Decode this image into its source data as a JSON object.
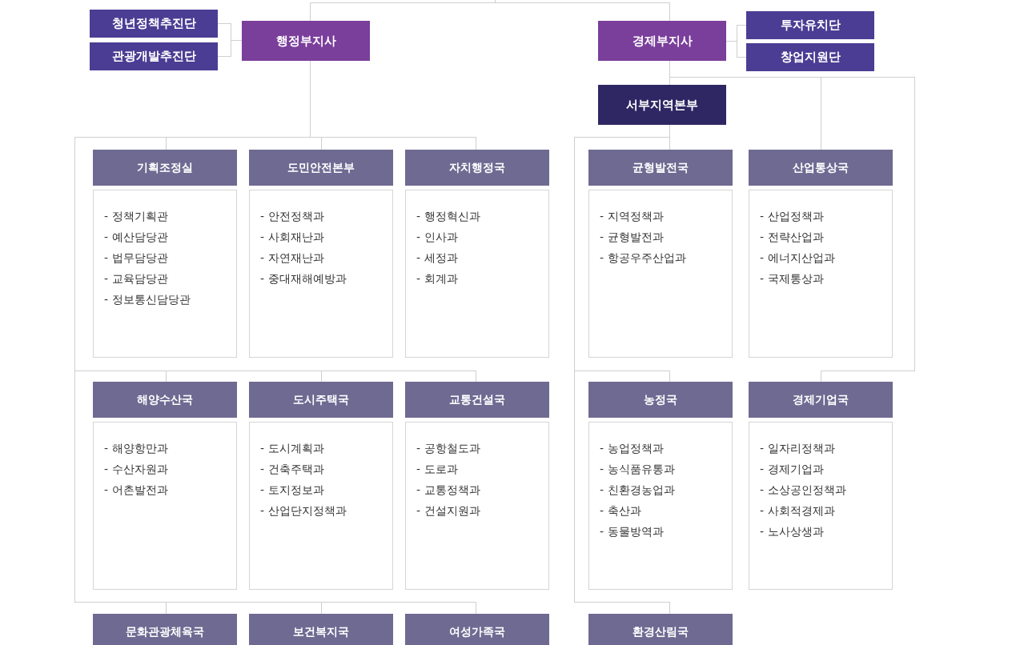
{
  "deputies": [
    {
      "name": "행정부지사",
      "kind": "deputy",
      "units": [
        {
          "name": "청년정책추진단",
          "kind": "unit"
        },
        {
          "name": "관광개발추진단",
          "kind": "unit"
        }
      ]
    },
    {
      "name": "경제부지사",
      "kind": "deputy",
      "units": [
        {
          "name": "투자유치단",
          "kind": "unit"
        },
        {
          "name": "창업지원단",
          "kind": "unit"
        }
      ]
    }
  ],
  "regional_hq": {
    "name": "서부지역본부",
    "kind": "hq"
  },
  "left_bureaus": [
    {
      "name": "기획조정실",
      "kind": "bureau",
      "items": [
        "- 정책기획관",
        "- 예산담당관",
        "- 법무담당관",
        "- 교육담당관",
        "- 정보통신담당관"
      ]
    },
    {
      "name": "도민안전본부",
      "kind": "bureau",
      "items": [
        "- 안전정책과",
        "- 사회재난과",
        "- 자연재난과",
        "- 중대재해예방과"
      ]
    },
    {
      "name": "자치행정국",
      "kind": "bureau",
      "items": [
        "- 행정혁신과",
        "- 인사과",
        "- 세정과",
        "- 회계과"
      ]
    },
    {
      "name": "해양수산국",
      "kind": "bureau",
      "items": [
        "- 해양항만과",
        "- 수산자원과",
        "- 어촌발전과"
      ]
    },
    {
      "name": "도시주택국",
      "kind": "bureau",
      "items": [
        "- 도시계획과",
        "- 건축주택과",
        "- 토지정보과",
        "- 산업단지정책과"
      ]
    },
    {
      "name": "교통건설국",
      "kind": "bureau",
      "items": [
        "- 공항철도과",
        "- 도로과",
        "- 교통정책과",
        "- 건설지원과"
      ]
    },
    {
      "name": "문화관광체육국",
      "kind": "bureau"
    },
    {
      "name": "보건복지국",
      "kind": "bureau"
    },
    {
      "name": "여성가족국",
      "kind": "bureau"
    }
  ],
  "right_bureaus": [
    {
      "name": "균형발전국",
      "kind": "bureau",
      "items": [
        "- 지역정책과",
        "- 균형발전과",
        "- 항공우주산업과"
      ]
    },
    {
      "name": "산업통상국",
      "kind": "bureau",
      "items": [
        "- 산업정책과",
        "- 전략산업과",
        "- 에너지산업과",
        "- 국제통상과"
      ]
    },
    {
      "name": "농정국",
      "kind": "bureau",
      "items": [
        "- 농업정책과",
        "- 농식품유통과",
        "- 친환경농업과",
        "- 축산과",
        "- 동물방역과"
      ]
    },
    {
      "name": "경제기업국",
      "kind": "bureau",
      "items": [
        "- 일자리정책과",
        "- 경제기업과",
        "- 소상공인정책과",
        "- 사회적경제과",
        "- 노사상생과"
      ]
    },
    {
      "name": "환경산림국",
      "kind": "bureau"
    }
  ]
}
